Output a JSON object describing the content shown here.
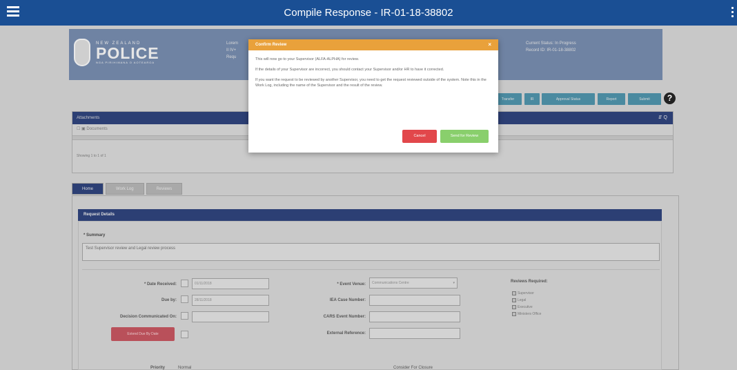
{
  "app": {
    "title": "Compile Response - IR-01-18-38802"
  },
  "header": {
    "logo_small": "NEW ZEALAND",
    "logo_big": "POLICE",
    "logo_tiny": "NGA PIRIHIMANA O AOTEAROA",
    "left_lines": [
      "Lorem",
      "II IV+",
      "Requ"
    ],
    "status_label": "Current Status: In Progress",
    "record_label": "Record ID: IR-01-18-38802"
  },
  "toolbar": {
    "buttons": [
      "Transfer",
      "IR",
      "Approval Status",
      "Report",
      "Submit"
    ],
    "help": "?"
  },
  "attachments": {
    "title": "Attachments",
    "row_label": "Documents",
    "showing": "Showing 1 to 1 of 1",
    "icons": "⇵ Q"
  },
  "tabs": [
    "Home",
    "Work Log",
    "Reviews"
  ],
  "request": {
    "section_title": "Request Details",
    "summary_label": "* Summary",
    "summary_value": "Test Supervisor review and Legal review process",
    "date_received_label": "* Date Received:",
    "date_received_value": "01/11/2018",
    "due_by_label": "Due by:",
    "due_by_value": "28/11/2018",
    "decision_label": "Decision Communicated On:",
    "red_button": "Extend Due By Date",
    "event_label": "* Event Venue:",
    "event_value": "Communications Centre",
    "iea_label": "IEA Case Number:",
    "cars_label": "CARS Event Number:",
    "external_label": "External Reference:",
    "reviews_title": "Reviews Required:",
    "reviews": [
      "Supervisor",
      "Legal",
      "Executive",
      "Ministers Office"
    ],
    "bottom_left": "Priority",
    "bottom_mid": "Normal",
    "bottom_right": "Consider For Closure"
  },
  "modal": {
    "title": "Confirm Review",
    "close": "×",
    "p1": "This will now go to your Supervisor (ALFA-ALPHA) for review.",
    "p2": "If the details of your Supervisor are incorrect, you should contact your Supervisor and/or HR to have it corrected.",
    "p3": "If you want the request to be reviewed by another Supervisor, you need to get the request reviewed outside of the system. Note this in the Work Log, including the name of the Supervisor and the result of the review.",
    "cancel": "Cancel",
    "send": "Send for Review"
  },
  "colors": {
    "topbar": "#1a4f94",
    "modal_header": "#e9a13b",
    "cancel": "#e2474b",
    "send": "#89cf6c"
  }
}
